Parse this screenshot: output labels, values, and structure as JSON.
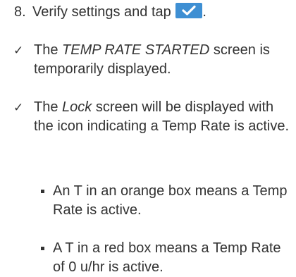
{
  "step": {
    "number": "8.",
    "text_before": "Verify settings and tap",
    "text_after": ".",
    "button_icon": "checkmark-icon",
    "button_color": "#3e8fd3"
  },
  "results": [
    {
      "mark": "✓",
      "text_before": "The ",
      "emphasis": "TEMP RATE STARTED",
      "text_after": " screen is temporarily displayed."
    },
    {
      "mark": "✓",
      "text_before": "The ",
      "emphasis": "Lock",
      "text_after": " screen will be displayed with the icon indicating a Temp Rate is active."
    }
  ],
  "bullets": [
    {
      "text": "An T in an orange box means a Temp Rate is active."
    },
    {
      "text": "A T in a red box means a Temp Rate of 0 u/hr is active."
    }
  ]
}
